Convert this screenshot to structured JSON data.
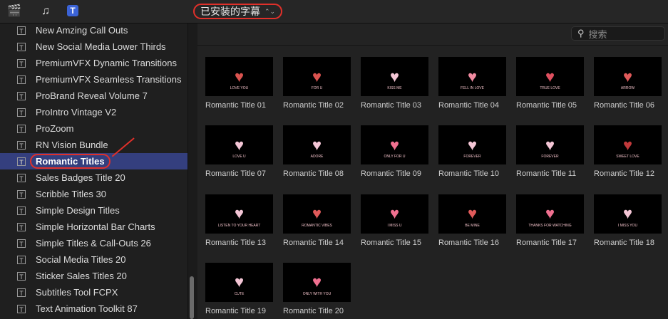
{
  "toolbar": {
    "selector_label": "已安装的字幕",
    "selector_chevron": "⌃⌄"
  },
  "search": {
    "placeholder": "搜索"
  },
  "sidebar": {
    "items": [
      {
        "label": "New Amzing Call Outs"
      },
      {
        "label": "New Social Media Lower Thirds"
      },
      {
        "label": "PremiumVFX Dynamic Transitions"
      },
      {
        "label": "PremiumVFX Seamless Transitions"
      },
      {
        "label": "ProBrand Reveal Volume 7"
      },
      {
        "label": "ProIntro Vintage V2"
      },
      {
        "label": "ProZoom"
      },
      {
        "label": "RN Vision Bundle"
      },
      {
        "label": "Romantic Titles",
        "selected": true
      },
      {
        "label": "Sales Badges Title 20"
      },
      {
        "label": "Scribble Titles 30"
      },
      {
        "label": "Simple Design Titles"
      },
      {
        "label": "Simple Horizontal Bar Charts"
      },
      {
        "label": "Simple Titles & Call-Outs 26"
      },
      {
        "label": "Social Media Titles 20"
      },
      {
        "label": "Sticker Sales Titles 20"
      },
      {
        "label": "Subtitles Tool FCPX"
      },
      {
        "label": "Text Animation Toolkit 87"
      }
    ]
  },
  "grid": {
    "tiles": [
      {
        "label": "Romantic Title 01",
        "art": "LOVE YOU",
        "color": "#d9534f"
      },
      {
        "label": "Romantic Title 02",
        "art": "FOR U",
        "color": "#d9534f"
      },
      {
        "label": "Romantic Title 03",
        "art": "KISS ME",
        "color": "#f4c6d6"
      },
      {
        "label": "Romantic Title 04",
        "art": "FELL IN LOVE",
        "color": "#f08aa0"
      },
      {
        "label": "Romantic Title 05",
        "art": "TRUE LOVE",
        "color": "#e05060"
      },
      {
        "label": "Romantic Title 06",
        "art": "ARROW",
        "color": "#e05a5a"
      },
      {
        "label": "Romantic Title 07",
        "art": "LOVE U",
        "color": "#f4c6d6"
      },
      {
        "label": "Romantic Title 08",
        "art": "ADORE",
        "color": "#f4c6d6"
      },
      {
        "label": "Romantic Title 09",
        "art": "ONLY FOR U",
        "color": "#f07090"
      },
      {
        "label": "Romantic Title 10",
        "art": "FOREVER",
        "color": "#f4c6d6"
      },
      {
        "label": "Romantic Title 11",
        "art": "FOREVER",
        "color": "#f4c6d6"
      },
      {
        "label": "Romantic Title 12",
        "art": "SWEET LOVE",
        "color": "#c0393b"
      },
      {
        "label": "Romantic Title 13",
        "art": "LISTEN TO YOUR HEART",
        "color": "#f4c6d6"
      },
      {
        "label": "Romantic Title 14",
        "art": "ROMANTIC VIBES",
        "color": "#e05a5a"
      },
      {
        "label": "Romantic Title 15",
        "art": "I MISS U",
        "color": "#f07090"
      },
      {
        "label": "Romantic Title 16",
        "art": "BE MINE",
        "color": "#e05a5a"
      },
      {
        "label": "Romantic Title 17",
        "art": "THANKS FOR WATCHING",
        "color": "#f07090"
      },
      {
        "label": "Romantic Title 18",
        "art": "I MISS YOU",
        "color": "#f4c6d6"
      },
      {
        "label": "Romantic Title 19",
        "art": "CUTE",
        "color": "#f4c6d6"
      },
      {
        "label": "Romantic Title 20",
        "art": "ONLY WITH YOU",
        "color": "#f07090"
      }
    ]
  }
}
